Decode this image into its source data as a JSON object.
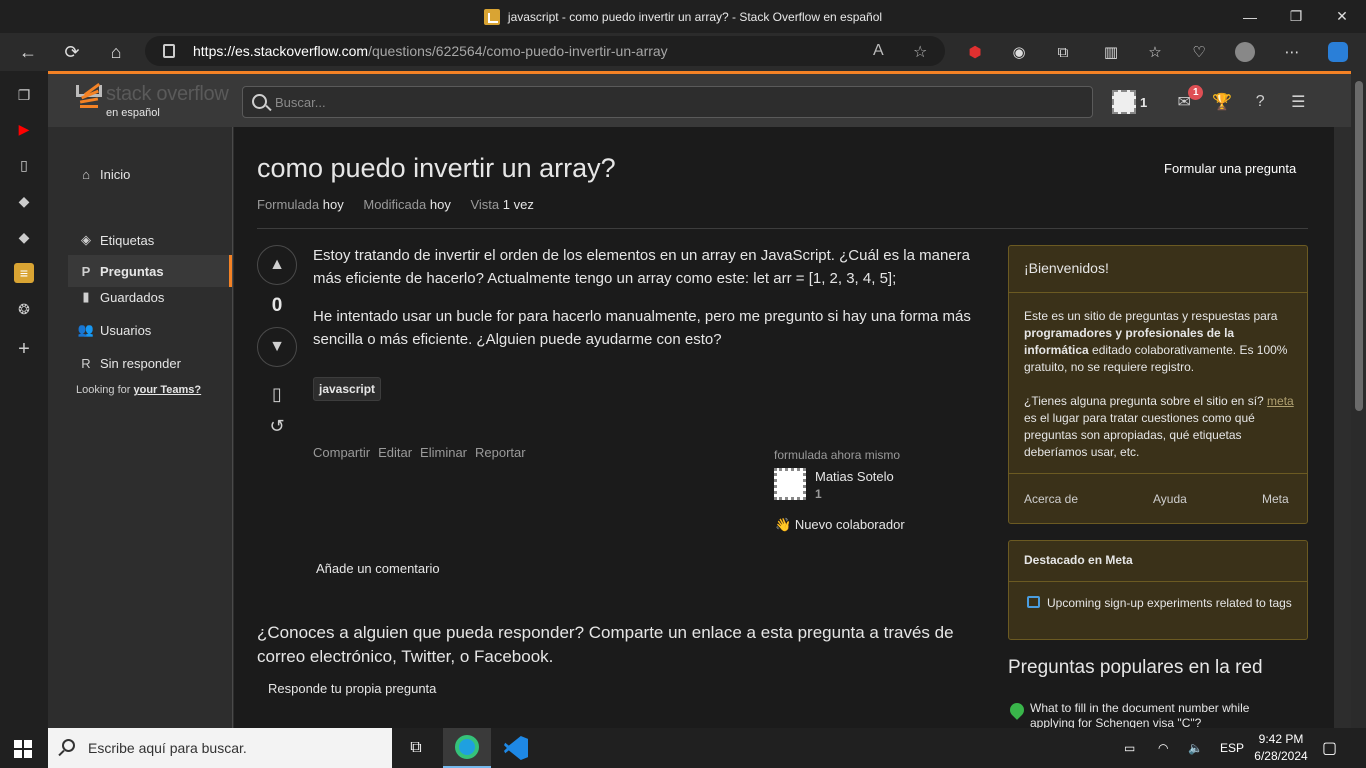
{
  "window": {
    "title": "javascript - como puedo invertir un array? - Stack Overflow en español",
    "controls": {
      "minimize": "—",
      "maximize": "❐",
      "close": "✕"
    }
  },
  "browser": {
    "url_host": "https://es.stackoverflow.com",
    "url_path": "/questions/622564/como-puedo-invertir-un-array"
  },
  "site": {
    "logo_word": "stack overflow",
    "logo_sub": "en español",
    "search_placeholder": "Buscar...",
    "reputation": "1",
    "inbox_count": "1"
  },
  "leftnav": {
    "items": [
      {
        "label": "Inicio",
        "icon": "home-icon"
      },
      {
        "label": "Preguntas",
        "icon": "questions-icon"
      },
      {
        "label": "Etiquetas",
        "icon": "tag-icon"
      },
      {
        "label": "Guardados",
        "icon": "bookmark-icon"
      },
      {
        "label": "Usuarios",
        "icon": "users-icon"
      },
      {
        "label": "Sin responder",
        "icon": "unanswered-icon"
      }
    ],
    "teams_prefix": "Looking for",
    "teams_link": "your Teams?"
  },
  "question": {
    "title": "como puedo invertir un array?",
    "ask_button": "Formular una pregunta",
    "asked_label": "Formulada",
    "asked_value": "hoy",
    "modified_label": "Modificada",
    "modified_value": "hoy",
    "viewed_label": "Vista",
    "viewed_value": "1 vez",
    "votes": "0",
    "body_p1": "Estoy tratando de invertir el orden de los elementos en un array en JavaScript. ¿Cuál es la manera más eficiente de hacerlo? Actualmente tengo un array como este: let arr = [1, 2, 3, 4, 5];",
    "body_p2": "He intentado usar un bucle for para hacerlo manualmente, pero me pregunto si hay una forma más sencilla o más eficiente. ¿Alguien puede ayudarme con esto?",
    "tag": "javascript",
    "actions": [
      "Compartir",
      "Editar",
      "Eliminar",
      "Reportar"
    ],
    "asked_time": "formulada ahora mismo",
    "author": "Matias Sotelo",
    "author_rep": "1",
    "new_contributor": "Nuevo colaborador",
    "add_comment": "Añade un comentario",
    "share_text": "¿Conoces a alguien que pueda responder? Comparte un enlace a esta pregunta a través de correo electrónico, Twitter, o Facebook.",
    "answer_own": "Responde tu propia pregunta"
  },
  "welcome": {
    "title": "¡Bienvenidos!",
    "p1_a": "Este es un sitio de preguntas y respuestas para ",
    "p1_b": "programadores y profesionales de la informática",
    "p1_c": " editado colaborativamente. Es 100% gratuito, no se requiere registro.",
    "p2_a": "¿Tienes alguna pregunta sobre el sitio en sí? ",
    "p2_link": "meta",
    "p2_b": " es el lugar para tratar cuestiones como qué preguntas son apropiadas, qué etiquetas deberíamos usar, etc.",
    "links": [
      "Acerca de",
      "Ayuda",
      "Meta"
    ]
  },
  "featured": {
    "title": "Destacado en Meta",
    "item": "Upcoming sign-up experiments related to tags"
  },
  "hot": {
    "title": "Preguntas populares en la red",
    "item": "What to fill in the document number while applying for Schengen visa \"C\"?"
  },
  "taskbar": {
    "search_placeholder": "Escribe aquí para buscar.",
    "lang": "ESP",
    "time": "9:42 PM",
    "date": "6/28/2024"
  }
}
